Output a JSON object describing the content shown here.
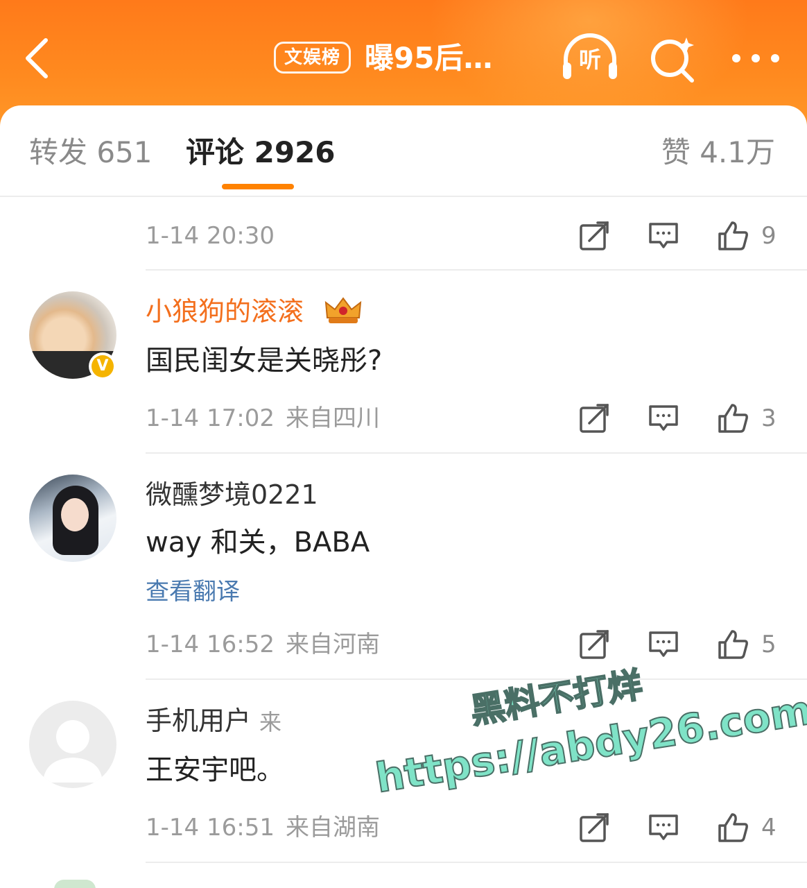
{
  "header": {
    "brand_badge": "文娱榜",
    "title": "曝95后…",
    "listen_label": "听",
    "colors": {
      "bar": "#ff7a1a",
      "accent": "#ff8200"
    },
    "icons": [
      "back-chevron-icon",
      "headphones-icon",
      "search-sparkle-icon",
      "more-dots-icon"
    ]
  },
  "tabs": {
    "forward": "转发 651",
    "comments": "评论 2926",
    "likes": "赞 4.1万"
  },
  "comments": [
    {
      "timestamp": "1-14 20:30",
      "location": "",
      "likes": "9"
    },
    {
      "username": "小狼狗的滚滚",
      "text": "国民闺女是关晓彤?",
      "timestamp": "1-14 17:02",
      "location": "来自四川",
      "likes": "3",
      "verified_mark": "V",
      "badge_icon": "crown-icon"
    },
    {
      "username": "微醺梦境0221",
      "text": "way 和关，BABA",
      "translate": "查看翻译",
      "timestamp": "1-14 16:52",
      "location": "来自河南",
      "likes": "5"
    },
    {
      "username": "手机用户",
      "username_suffix": "来",
      "text": "王安宇吧。",
      "timestamp": "1-14 16:51",
      "location": "来自湖南",
      "likes": "4"
    }
  ],
  "watermark": {
    "line1": "黑料不打烊",
    "line2": "https://abdy26.com"
  }
}
